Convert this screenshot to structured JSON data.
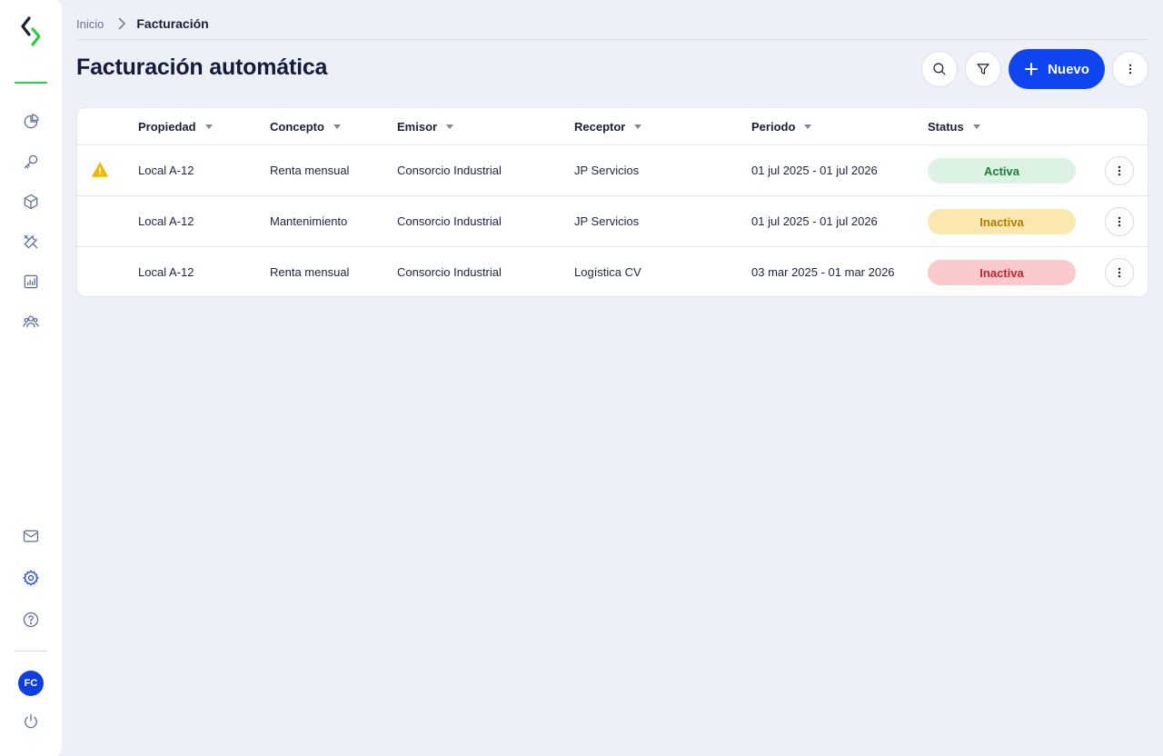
{
  "sidebar": {
    "nav": [
      "dashboard",
      "keys",
      "inventory",
      "tools",
      "reports",
      "users"
    ],
    "bottom": [
      "mail",
      "settings",
      "help"
    ],
    "avatar_initials": "FC"
  },
  "breadcrumb": {
    "home": "Inicio",
    "current": "Facturación"
  },
  "page": {
    "title": "Facturación automática",
    "new_button": "Nuevo"
  },
  "table": {
    "headers": {
      "propiedad": "Propiedad",
      "concepto": "Concepto",
      "emisor": "Emisor",
      "receptor": "Receptor",
      "periodo": "Periodo",
      "status": "Status"
    },
    "rows": [
      {
        "warning": true,
        "propiedad": "Local A-12",
        "concepto": "Renta mensual",
        "emisor": "Consorcio Industrial",
        "receptor": "JP Servicios",
        "periodo": "01 jul 2025 - 01 jul 2026",
        "status": "Activa",
        "status_bg": "#dcf3e3",
        "status_color": "#1e7a3a"
      },
      {
        "warning": false,
        "propiedad": "Local A-12",
        "concepto": "Mantenimiento",
        "emisor": "Consorcio Industrial",
        "receptor": "JP Servicios",
        "periodo": "01 jul 2025 - 01 jul 2026",
        "status": "Inactiva",
        "status_bg": "#fbe8b0",
        "status_color": "#b07a00"
      },
      {
        "warning": false,
        "propiedad": "Local A-12",
        "concepto": "Renta mensual",
        "emisor": "Consorcio Industrial",
        "receptor": "Logística CV",
        "periodo": "03 mar 2025 - 01 mar 2026",
        "status": "Inactiva",
        "status_bg": "#fac9cc",
        "status_color": "#c0262f"
      }
    ]
  },
  "colors": {
    "accent": "#0f45f0",
    "brand_green": "#2ecc40",
    "warning": "#f2b705"
  }
}
